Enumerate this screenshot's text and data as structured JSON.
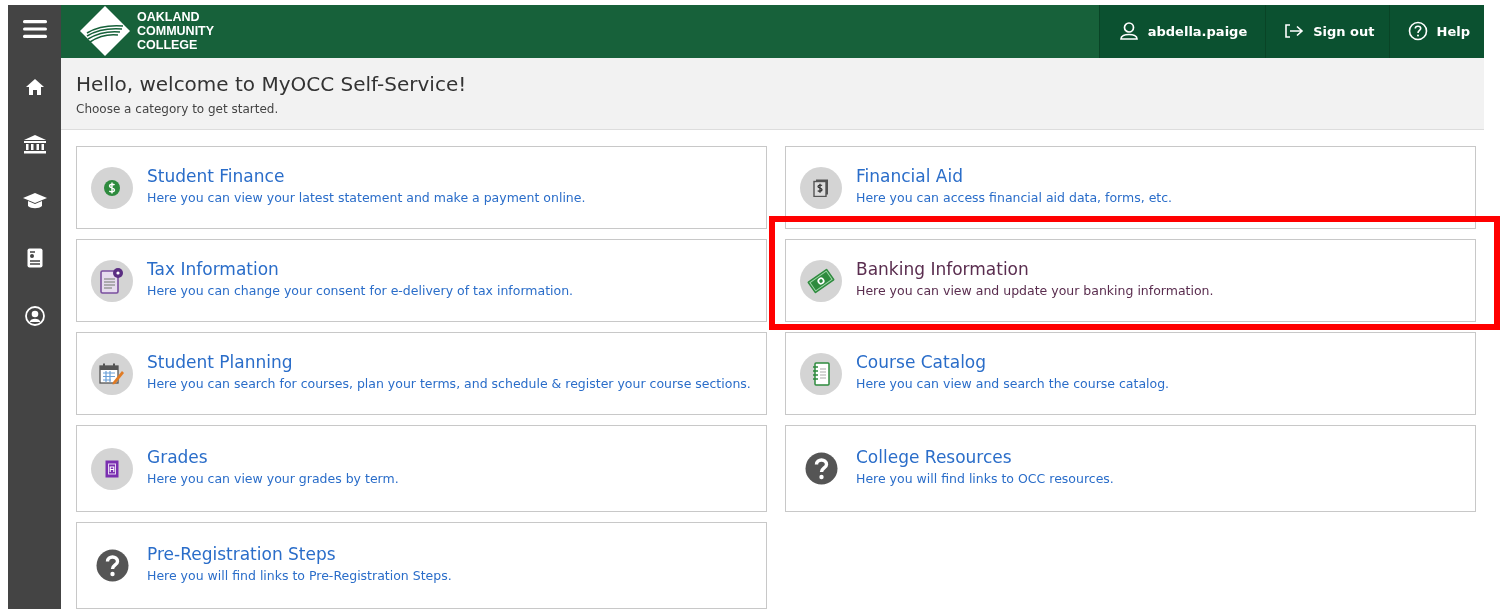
{
  "header": {
    "logo_text": [
      "OAKLAND",
      "COMMUNITY",
      "COLLEGE"
    ],
    "user": "abdella.paige",
    "sign_out": "Sign out",
    "help": "Help"
  },
  "sidebar": {
    "items": [
      {
        "kind": "home"
      },
      {
        "kind": "bank"
      },
      {
        "kind": "cap"
      },
      {
        "kind": "statement"
      },
      {
        "kind": "profile"
      }
    ]
  },
  "welcome": {
    "title": "Hello, welcome to MyOCC Self-Service!",
    "subtitle": "Choose a category to get started."
  },
  "cards": [
    {
      "kind": "finance",
      "title": "Student Finance",
      "description": "Here you can view your latest statement and make a payment online.",
      "highlighted": false
    },
    {
      "kind": "aid",
      "title": "Financial Aid",
      "description": "Here you can access financial aid data, forms, etc.",
      "highlighted": false
    },
    {
      "kind": "tax",
      "title": "Tax Information",
      "description": "Here you can change your consent for e-delivery of tax information.",
      "highlighted": false
    },
    {
      "kind": "banking",
      "title": "Banking Information",
      "description": "Here you can view and update your banking information.",
      "highlighted": true
    },
    {
      "kind": "planning",
      "title": "Student Planning",
      "description": "Here you can search for courses, plan your terms, and schedule & register your course sections.",
      "highlighted": false
    },
    {
      "kind": "catalog",
      "title": "Course Catalog",
      "description": "Here you can view and search the course catalog.",
      "highlighted": false
    },
    {
      "kind": "grades",
      "title": "Grades",
      "description": "Here you can view your grades by term.",
      "highlighted": false
    },
    {
      "kind": "question",
      "title": "College Resources",
      "description": "Here you will find links to OCC resources.",
      "highlighted": false
    },
    {
      "kind": "question",
      "title": "Pre-Registration Steps",
      "description": "Here you will find links to Pre-Registration Steps.",
      "highlighted": false
    }
  ]
}
